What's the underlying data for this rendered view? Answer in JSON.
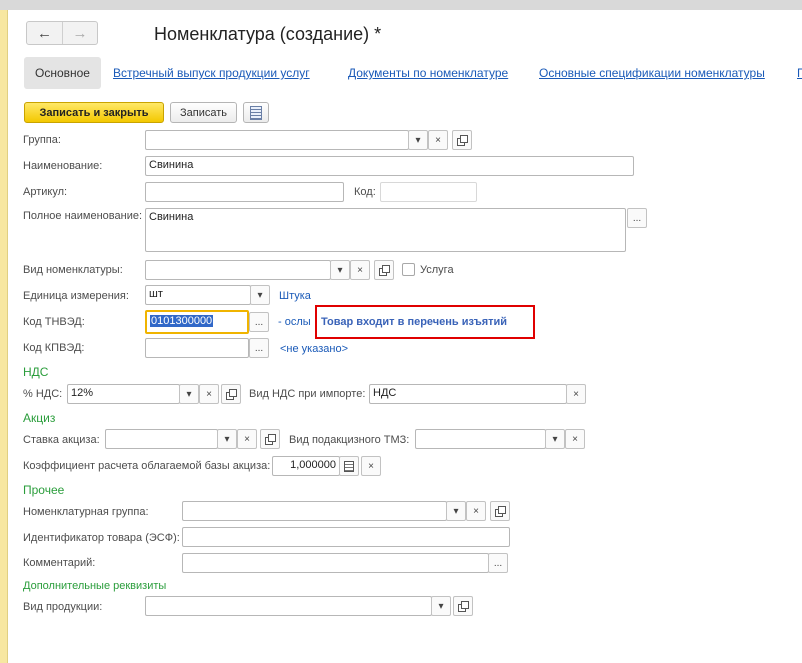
{
  "window": {
    "title": "Номенклатура (создание) *",
    "nav": {
      "back_icon": "←",
      "forward_icon": "→"
    }
  },
  "tabs": [
    {
      "label": "Основное",
      "active": true
    },
    {
      "label": "Встречный выпуск продукции услуг"
    },
    {
      "label": "Документы по номенклатуре"
    },
    {
      "label": "Основные спецификации номенклатуры"
    },
    {
      "label": "П"
    }
  ],
  "toolbar": {
    "save_close_label": "Записать и закрыть",
    "save_label": "Записать"
  },
  "form": {
    "group": {
      "label": "Группа:",
      "value": ""
    },
    "name": {
      "label": "Наименование:",
      "value": "Свинина"
    },
    "article": {
      "label": "Артикул:",
      "value": ""
    },
    "code": {
      "label": "Код:",
      "value": ""
    },
    "full_name": {
      "label": "Полное наименование:",
      "value": "Свинина"
    },
    "kind": {
      "label": "Вид номенклатуры:",
      "value": ""
    },
    "service": {
      "label": "Услуга",
      "checked": false
    },
    "unit": {
      "label": "Единица измерения:",
      "value": "шт",
      "hint": "Штука"
    },
    "tnved": {
      "label": "Код ТНВЭД:",
      "value": "0101300000",
      "hint": "- ослы",
      "warning": "Товар входит в перечень изъятий"
    },
    "kpved": {
      "label": "Код КПВЭД:",
      "value": "",
      "hint": "<не указано>"
    }
  },
  "vat": {
    "section": "НДС",
    "rate": {
      "label": "% НДС:",
      "value": "12%"
    },
    "import_kind": {
      "label": "Вид НДС при импорте:",
      "value": "НДС"
    }
  },
  "excise": {
    "section": "Акциз",
    "rate": {
      "label": "Ставка акциза:",
      "value": ""
    },
    "goods_kind": {
      "label": "Вид подакцизного ТМЗ:",
      "value": ""
    },
    "coefficient": {
      "label": "Коэффициент расчета облагаемой базы акциза:",
      "value": "1,000000"
    }
  },
  "other": {
    "section": "Прочее",
    "nom_group": {
      "label": "Номенклатурная группа:",
      "value": ""
    },
    "esf_id": {
      "label": "Идентификатор товара (ЭСФ):",
      "value": ""
    },
    "comment": {
      "label": "Комментарий:",
      "value": ""
    },
    "additional_link": "Дополнительные реквизиты",
    "product_kind": {
      "label": "Вид продукции:",
      "value": ""
    }
  },
  "icons": {
    "dropdown": "▾",
    "clear": "×",
    "more": "...",
    "names": [
      "back-arrow-icon",
      "forward-arrow-icon",
      "dropdown-arrow-icon",
      "clear-icon",
      "open-copy-icon",
      "ellipsis-icon",
      "calculator-icon",
      "list-icon"
    ]
  },
  "colors": {
    "primary_button": "#f3c800",
    "link": "#1a5ab8",
    "section": "#2a9d3b",
    "warning_border": "#e00000",
    "focus_border": "#f0b400"
  }
}
